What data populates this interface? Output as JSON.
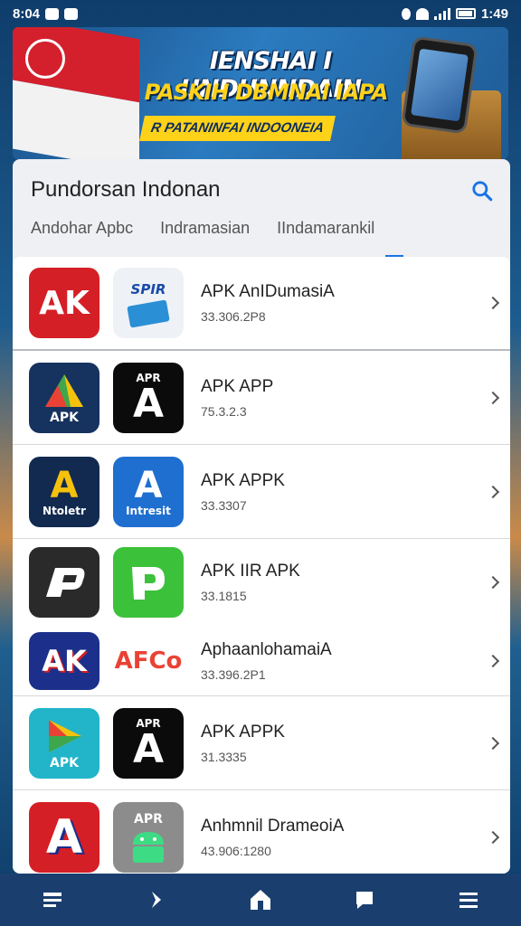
{
  "status_bar": {
    "time_left": "8:04",
    "time_right": "1:49"
  },
  "banner": {
    "title": "IENSHAI I UNDUNNDAIN",
    "subtitle": "PASKIH DBMNAI IAPA",
    "tag": "R PATANINFAI INDOONEIA"
  },
  "panel": {
    "title": "Pundorsan Indonan",
    "tabs": [
      {
        "label": "Andohar Apbc"
      },
      {
        "label": "Indramasian"
      },
      {
        "label": "IIndamarankil"
      }
    ]
  },
  "apps": [
    {
      "name": "APK AnIDumasiA",
      "version": "33.306.2P8",
      "icon_a_text": "AK",
      "icon_b_text": "SPIR"
    },
    {
      "name": "APK APP",
      "version": "75.3.2.3",
      "icon_a_text": "APK",
      "icon_b_text": "APR"
    },
    {
      "name": "APK APPK",
      "version": "33.3307",
      "icon_a_text": "Ntoletr",
      "icon_b_text": "Intresit"
    },
    {
      "name": "APK IIR APK",
      "version": "33.1815",
      "icon_a_text": "",
      "icon_b_text": ""
    },
    {
      "name": "AphaanlohamaiA",
      "version": "33.396.2P1",
      "icon_a_text": "AK",
      "icon_b_text": "AFCo"
    },
    {
      "name": "APK APPK",
      "version": "31.3335",
      "icon_a_text": "APK",
      "icon_b_text": "APR"
    },
    {
      "name": "Anhmnil DrameoiA",
      "version": "43.906:1280",
      "icon_a_text": "",
      "icon_b_text": "APR"
    }
  ],
  "icons": {
    "search": "search-icon",
    "chevron": "chevron-right-icon",
    "nav": [
      "list-icon",
      "forward-icon",
      "home-icon",
      "chat-icon",
      "menu-icon"
    ]
  },
  "colors": {
    "accent": "#1a73e8",
    "nav_bg": "#1a3f6e",
    "banner_yellow": "#ffd21a"
  }
}
